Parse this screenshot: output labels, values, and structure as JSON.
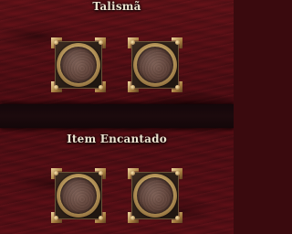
{
  "sections": [
    {
      "title": "Talismã",
      "slots": [
        {
          "state": "empty"
        },
        {
          "state": "empty"
        }
      ]
    },
    {
      "title": "Item Encantado",
      "slots": [
        {
          "state": "empty"
        },
        {
          "state": "empty"
        }
      ]
    }
  ],
  "colors": {
    "background": "#4a0d13",
    "band": "#1c0a0d",
    "title_text": "#ece2cf",
    "frame_gold": "#c9a868",
    "socket": "#5f4239"
  }
}
